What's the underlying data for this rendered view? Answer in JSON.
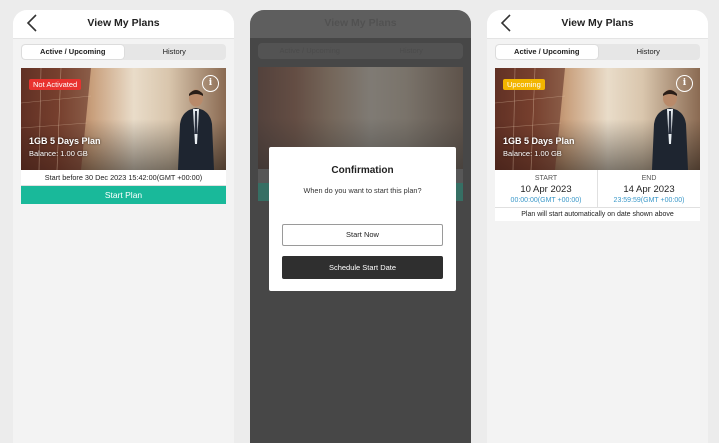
{
  "header": {
    "title": "View My Plans"
  },
  "tabs": {
    "active": "Active / Upcoming",
    "history": "History"
  },
  "plan": {
    "name": "1GB 5 Days Plan",
    "balance": "Balance: 1.00 GB"
  },
  "screen1": {
    "badge": "Not Activated",
    "badge_color": "#e8322f",
    "start_before": "Start before 30 Dec 2023 15:42:00(GMT +00:00)",
    "start_button": "Start Plan",
    "button_color": "#19b99a"
  },
  "modal": {
    "title": "Confirmation",
    "message": "When do you want to start this plan?",
    "start_now": "Start Now",
    "schedule": "Schedule Start Date"
  },
  "screen3": {
    "badge": "Upcoming",
    "badge_color": "#f2b500",
    "start_label": "START",
    "start_date": "10 Apr 2023",
    "start_time": "00:00:00(GMT +00:00)",
    "end_label": "END",
    "end_date": "14 Apr 2023",
    "end_time": "23:59:59(GMT +00:00)",
    "note": "Plan will start automatically on date shown above"
  },
  "icons": {
    "back": "chevron-left-icon",
    "info": "info-icon"
  }
}
